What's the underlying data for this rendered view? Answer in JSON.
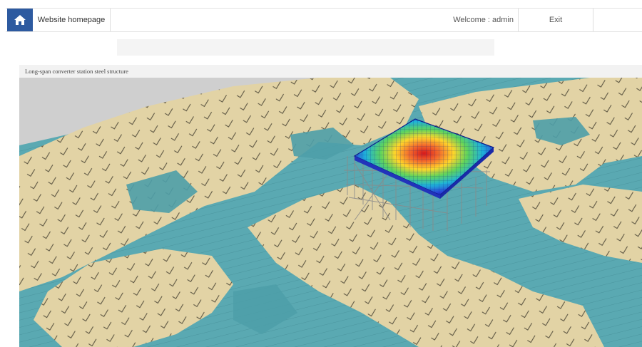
{
  "topbar": {
    "home_icon": "home-icon",
    "homepage_label": "Website homepage",
    "welcome_text": "Welcome : admin",
    "exit_label": "Exit"
  },
  "search": {
    "placeholder": ""
  },
  "panel": {
    "title": "Long-span converter station steel structure"
  },
  "colors": {
    "accent": "#2d5aa0",
    "terrain_sand": "#e3d3a6",
    "terrain_water": "#57a9b3",
    "header_bg": "#f2f2f2"
  }
}
